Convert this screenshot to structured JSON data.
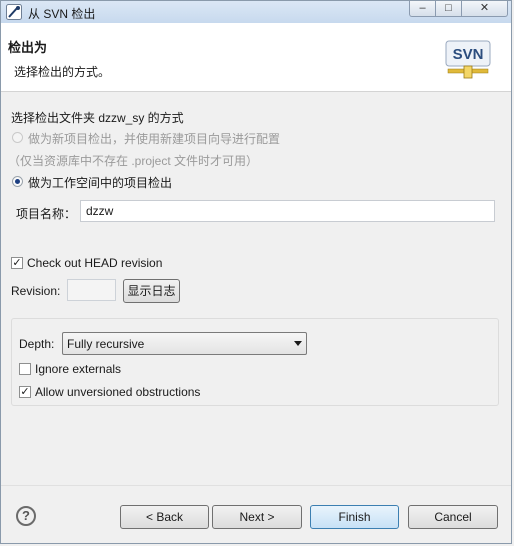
{
  "window": {
    "title": "从 SVN 检出"
  },
  "banner": {
    "title": "检出为",
    "description": "选择检出的方式。",
    "logo_text": "SVN",
    "logo_icon": "svn-connector-icon"
  },
  "checkout_method": {
    "heading": "选择检出文件夹 dzzw_sy 的方式",
    "option_new_project": "做为新项目检出，并使用新建项目向导进行配置",
    "option_new_project_note": "（仅当资源库中不存在 .project 文件时才可用）",
    "option_workspace": "做为工作空间中的项目检出",
    "selected": "option_workspace"
  },
  "project_name": {
    "label": "项目名称：",
    "value": "dzzw"
  },
  "head_revision": {
    "label": "Check out HEAD revision",
    "checked": true
  },
  "revision": {
    "label": "Revision:",
    "value": "",
    "show_log_label": "显示日志"
  },
  "depth": {
    "label": "Depth:",
    "value": "Fully recursive",
    "ignore_externals_label": "Ignore externals",
    "ignore_externals_checked": false,
    "allow_obstructions_label": "Allow unversioned obstructions",
    "allow_obstructions_checked": true
  },
  "buttons": {
    "help": "?",
    "back": "< Back",
    "next": "Next >",
    "finish": "Finish",
    "cancel": "Cancel"
  }
}
